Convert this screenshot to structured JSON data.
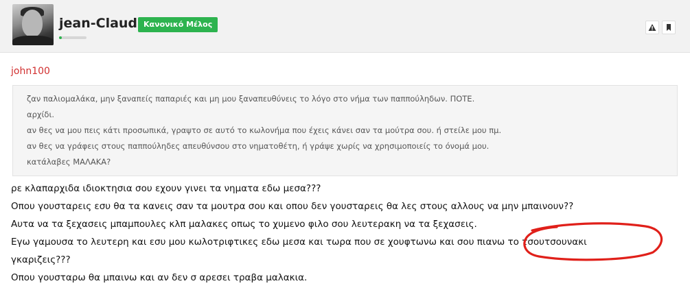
{
  "post": {
    "author": {
      "username": "jean-Claud",
      "role_badge": "Κανονικό Μέλος",
      "reputation_fraction": 0.1,
      "avatar": "avatar-photo"
    },
    "actions": [
      {
        "icon": "warning-triangle-icon"
      },
      {
        "icon": "bookmark-icon"
      }
    ],
    "quote": {
      "author": "john100",
      "lines": [
        "ζαν παλιομαλάκα, μην ξαναπείς παπαριές και μη μου ξαναπευθύνεις το λόγο στο νήμα των παππούληδων. ΠΟΤΕ.",
        "αρχίδι.",
        "αν θες να μου πεις κάτι προσωπικά, γραψτο σε αυτό το κωλονήμα που έχεις κάνει σαν τα μούτρα σου. ή στείλε μου πμ.",
        "αν θες να γράφεις στους παππούληδες απευθύνσου στο νηματοθέτη, ή γράψε χωρίς να χρησιμοποιείς το όνομά μου.",
        "κατάλαβες ΜΑΛΑΚΑ?"
      ]
    },
    "body_lines": [
      "ρε κλαπαρχιδα ιδιοκτησια σου εχουν γινει τα νηματα εδω μεσα???",
      "Οπου γουσταρεις εσυ θα τα κανεις σαν τα μουτρα σου και οπου δεν γουσταρεις θα λες στους αλλους να μην μπαινουν??",
      "Αυτα να τα ξεχασεις μπαμπουλες κλπ μαλακες οπως το χυμενο φιλο σου λευτερακη να τα ξεχασεις.",
      "Εγω γαμουσα το λευτερη και εσυ μου κωλοτριφτικες εδω μεσα και τωρα που σε χουφτωνω και σου πιανω το τσουτσουνακι",
      "γκαριζεις???",
      "Οπου γουσταρω θα μπαινω και αν δεν σ αρεσει τραβα μαλακια."
    ],
    "annotation_color": "#e0201a"
  }
}
